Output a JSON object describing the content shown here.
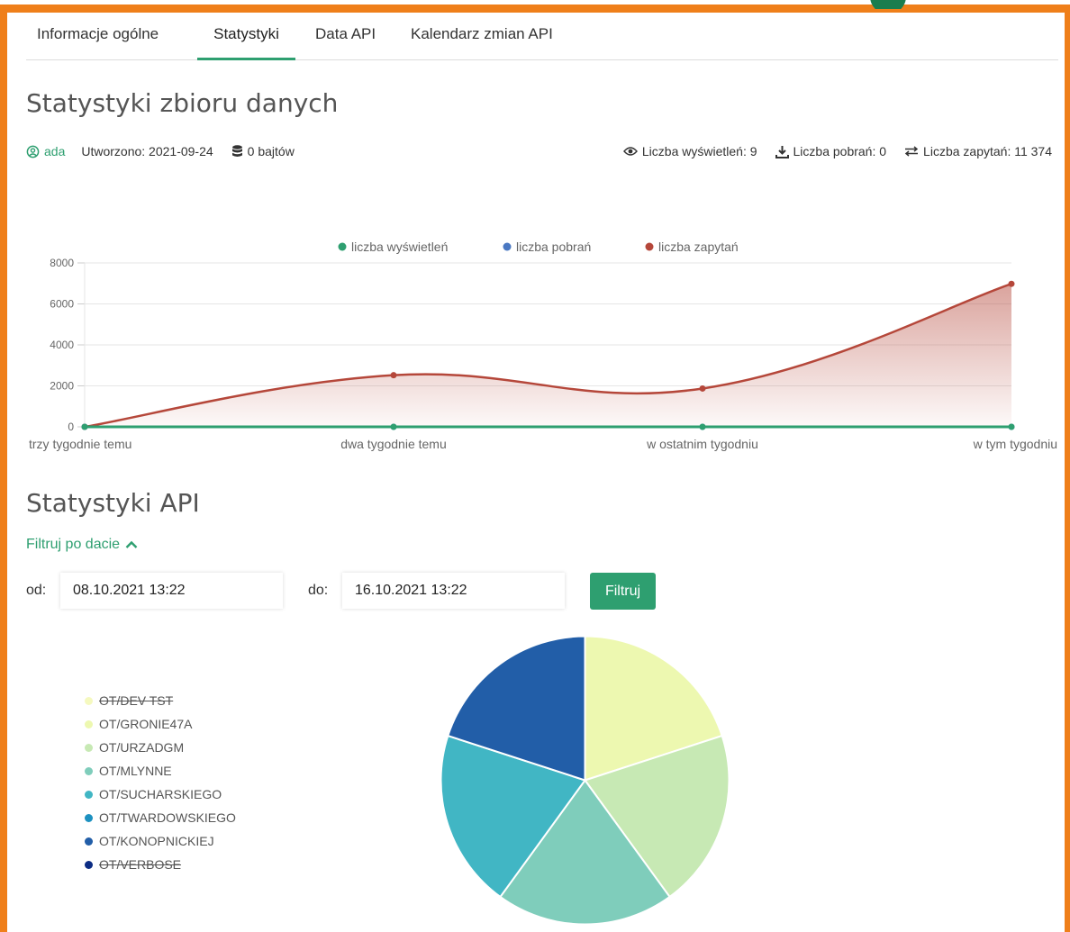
{
  "tabs": [
    {
      "label": "Informacje ogólne"
    },
    {
      "label": "Statystyki"
    },
    {
      "label": "Data API"
    },
    {
      "label": "Kalendarz zmian API"
    }
  ],
  "dataset_stats": {
    "title": "Statystyki zbioru danych",
    "user": "ada",
    "created": "Utworzono: 2021-09-24",
    "size": "0 bajtów",
    "views": "Liczba wyświetleń: 9",
    "downloads": "Liczba pobrań: 0",
    "queries": "Liczba zapytań: 11 374"
  },
  "api_stats": {
    "title": "Statystyki API",
    "filter_toggle": "Filtruj po dacie",
    "from_label": "od:",
    "from_value": "08.10.2021 13:22",
    "to_label": "do:",
    "to_value": "16.10.2021 13:22",
    "filter_button": "Filtruj"
  },
  "colors": {
    "accent": "#2e9f70",
    "frame": "#ef7f1a",
    "views": "#2e9f70",
    "downloads": "#4a78c2",
    "queries": "#b5473a"
  },
  "chart_data": [
    {
      "type": "area",
      "categories": [
        "trzy tygodnie temu",
        "dwa tygodnie temu",
        "w ostatnim tygodniu",
        "w tym tygodniu"
      ],
      "series": [
        {
          "name": "liczba wyświetleń",
          "values": [
            0,
            0,
            0,
            0
          ],
          "color": "#2e9f70"
        },
        {
          "name": "liczba pobrań",
          "values": [
            0,
            0,
            0,
            0
          ],
          "color": "#4a78c2"
        },
        {
          "name": "liczba zapytań",
          "values": [
            0,
            2520,
            1870,
            6980
          ],
          "color": "#b5473a"
        }
      ],
      "yticks": [
        "0",
        "2000",
        "4000",
        "6000",
        "8000"
      ],
      "ylim": [
        0,
        8000
      ],
      "grid": true,
      "legend": "top-center"
    },
    {
      "type": "pie",
      "legend_position": "left",
      "slices": [
        {
          "label": "OT/DEV TST",
          "value": 0,
          "color": "#f5f9bf",
          "hidden": true
        },
        {
          "label": "OT/GRONIE47A",
          "value": 1,
          "color": "#edf8b0"
        },
        {
          "label": "OT/URZADGM",
          "value": 1,
          "color": "#c7e9b4"
        },
        {
          "label": "OT/MLYNNE",
          "value": 1,
          "color": "#7fcdbb"
        },
        {
          "label": "OT/SUCHARSKIEGO",
          "value": 1,
          "color": "#41b6c4"
        },
        {
          "label": "OT/TWARDOWSKIEGO",
          "value": 0,
          "color": "#1d91c0"
        },
        {
          "label": "OT/KONOPNICKIEJ",
          "value": 1,
          "color": "#225ea8"
        },
        {
          "label": "OT/VERBOSE",
          "value": 0,
          "color": "#0c2c84",
          "hidden": true
        }
      ]
    }
  ]
}
